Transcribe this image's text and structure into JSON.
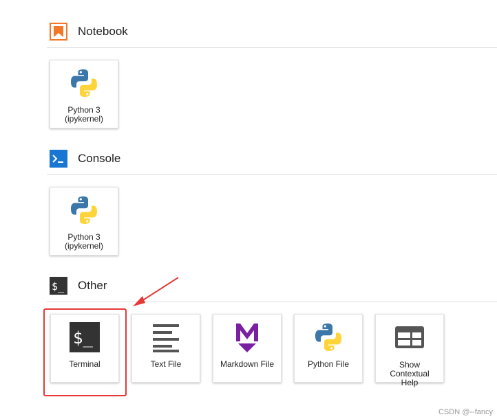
{
  "sections": {
    "notebook": {
      "title": "Notebook",
      "icon": "notebook-bookmark-icon",
      "color": "#f37726",
      "cards": [
        {
          "label_line1": "Python 3",
          "label_line2": "(ipykernel)",
          "icon": "python-logo-icon"
        }
      ]
    },
    "console": {
      "title": "Console",
      "icon": "console-prompt-icon",
      "color": "#1976d2",
      "cards": [
        {
          "label_line1": "Python 3",
          "label_line2": "(ipykernel)",
          "icon": "python-logo-icon"
        }
      ]
    },
    "other": {
      "title": "Other",
      "icon": "terminal-dollar-icon",
      "color": "#333333",
      "cards": [
        {
          "label": "Terminal",
          "icon": "terminal-dollar-icon"
        },
        {
          "label": "Text File",
          "icon": "text-lines-icon"
        },
        {
          "label": "Markdown File",
          "icon": "markdown-m-icon"
        },
        {
          "label": "Python File",
          "icon": "python-logo-icon"
        },
        {
          "label_line1": "Show",
          "label_line2": "Contextual",
          "label_line3": "Help",
          "icon": "contextual-help-window-icon"
        }
      ]
    }
  },
  "annotation": {
    "color": "#e53935",
    "target": "Terminal"
  },
  "watermark": "CSDN @--fancy"
}
